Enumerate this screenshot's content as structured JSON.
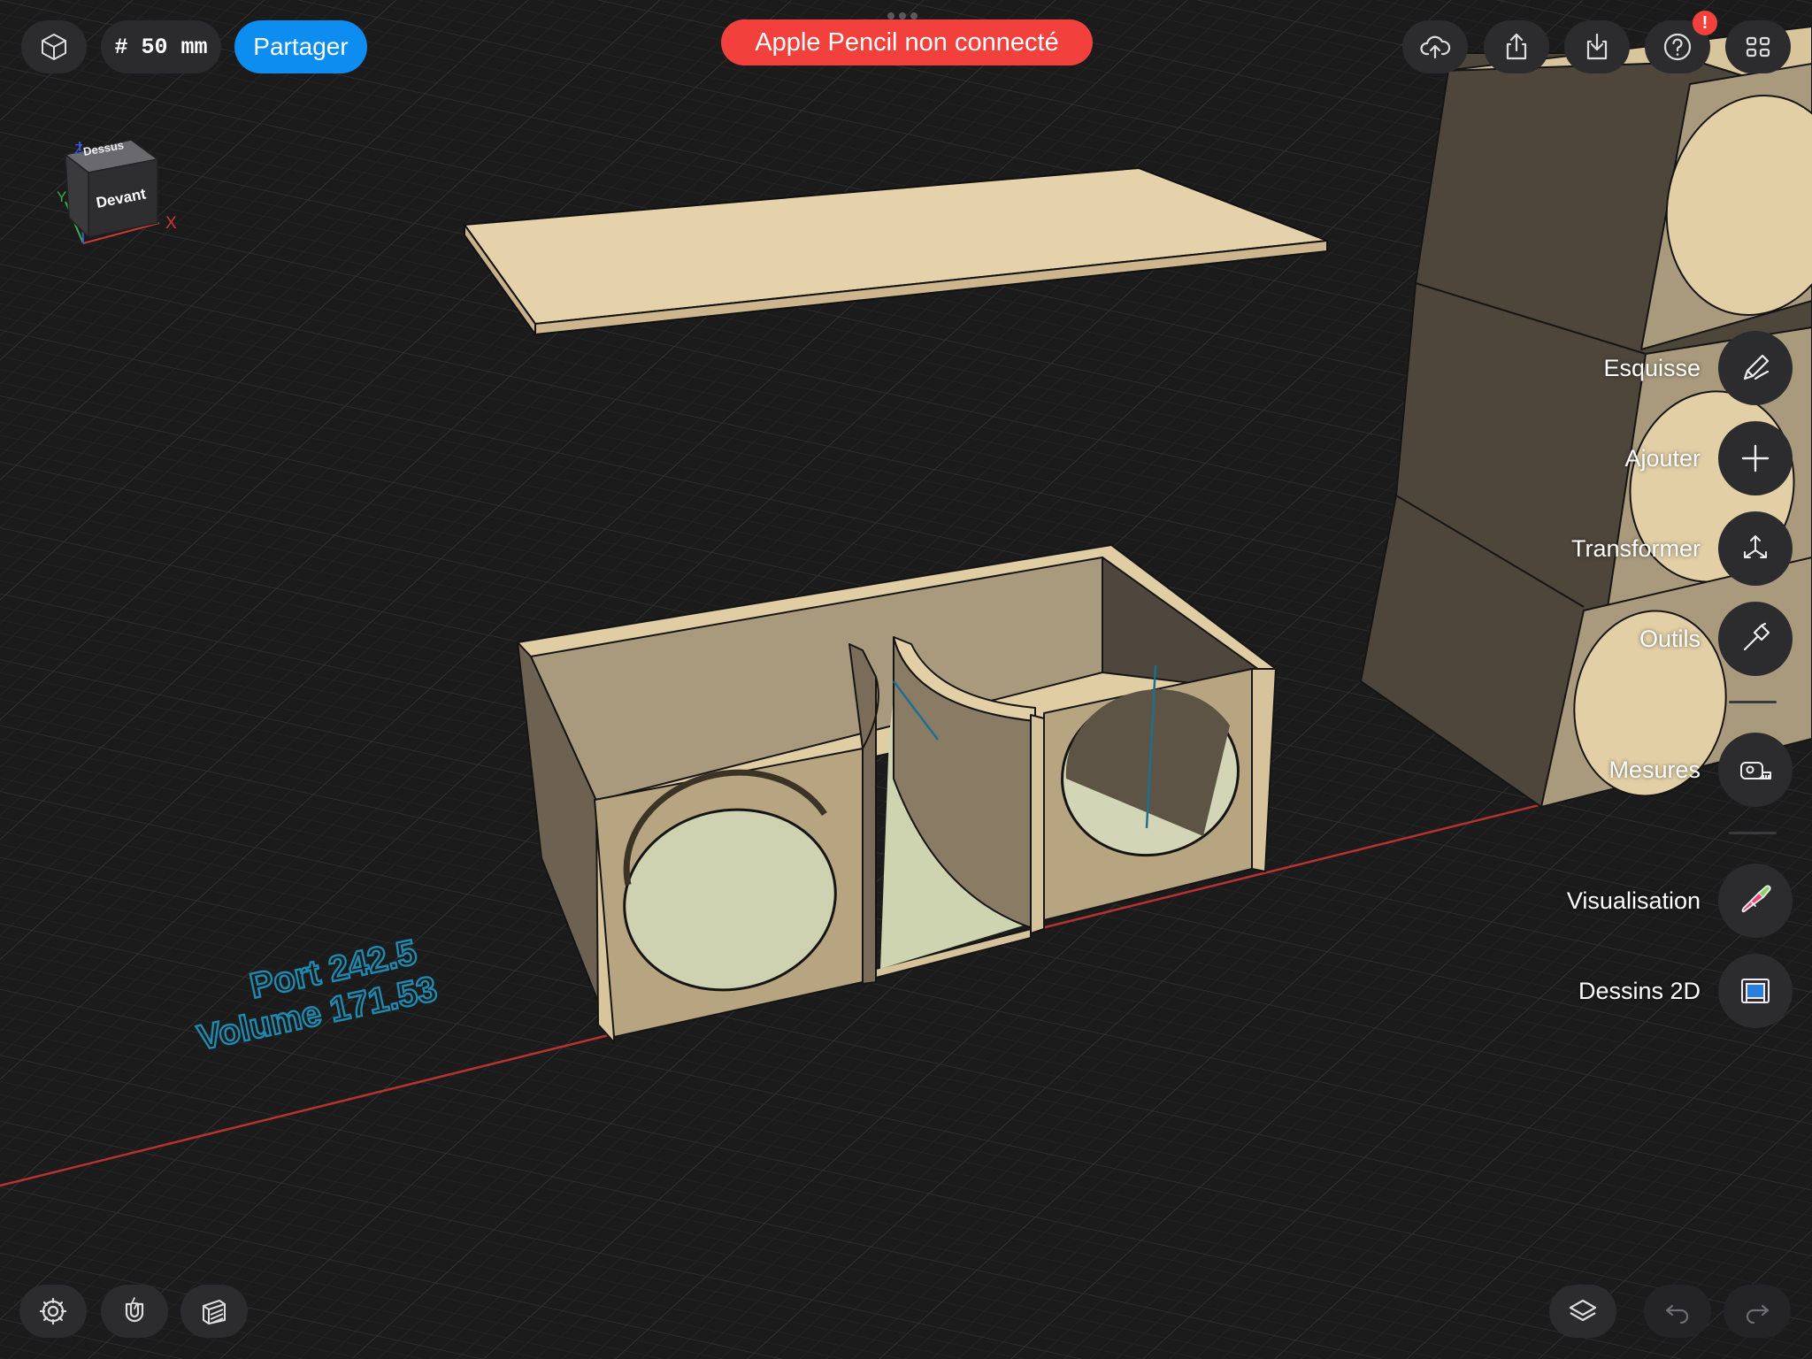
{
  "toolbar": {
    "grid_size": "# 50 mm",
    "share_label": "Partager",
    "pencil_status": "Apple Pencil non connecté",
    "help_badge": "!"
  },
  "view_cube": {
    "top_label": "Dessus",
    "front_label": "Devant",
    "axis_x": "X",
    "axis_y": "Y",
    "axis_z": "Z"
  },
  "annotations": {
    "port": "Port 242.5",
    "volume": "Volume 171.53"
  },
  "tools": [
    {
      "label": "Esquisse",
      "icon": "pencil-icon"
    },
    {
      "label": "Ajouter",
      "icon": "plus-icon"
    },
    {
      "label": "Transformer",
      "icon": "transform-arrows-icon"
    },
    {
      "label": "Outils",
      "icon": "hammer-icon"
    },
    {
      "label": "Mesures",
      "icon": "tape-measure-icon"
    },
    {
      "label": "Visualisation",
      "icon": "paint-brush-icon"
    },
    {
      "label": "Dessins 2D",
      "icon": "blueprint-icon"
    }
  ],
  "colors": {
    "share_button": "#0e8df0",
    "pencil_banner": "#f2413d",
    "wood": "#e3cfa6",
    "annotation_text": "#1f8ab0",
    "x_axis_line": "#b8322f"
  }
}
